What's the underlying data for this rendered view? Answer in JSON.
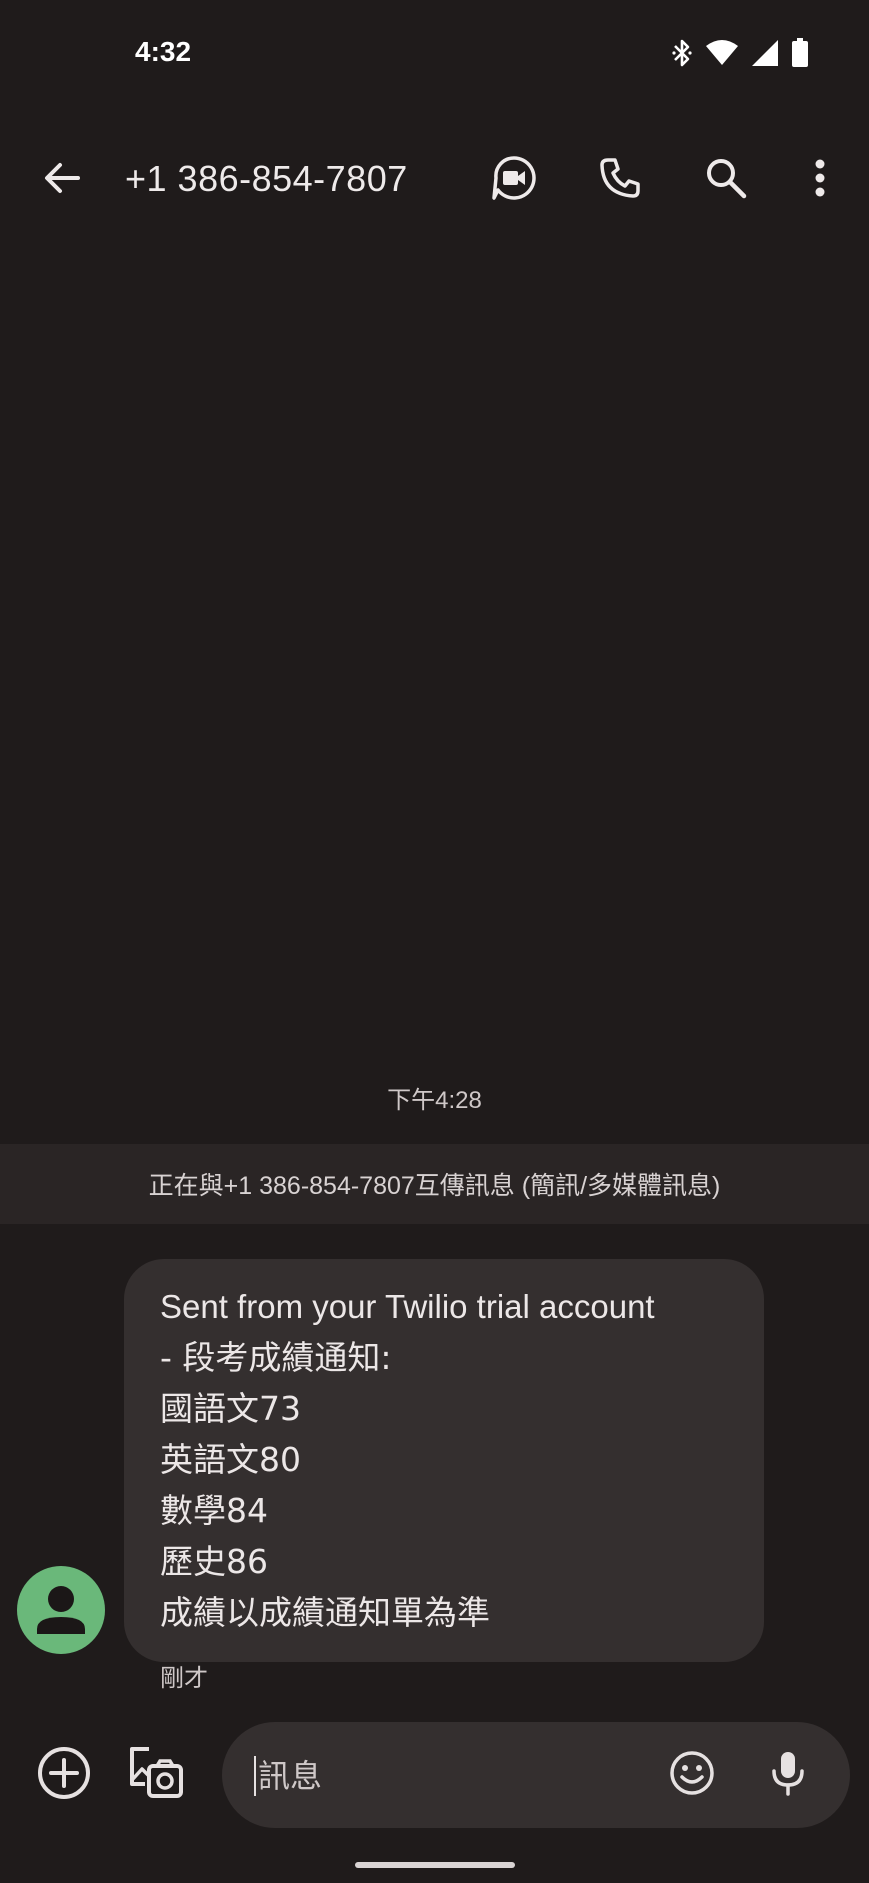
{
  "status_bar": {
    "time": "4:32"
  },
  "app_bar": {
    "title": "+1 386-854-7807"
  },
  "conversation": {
    "timestamp": "下午4:28",
    "info_banner": "正在與+1 386-854-7807互傳訊息 (簡訊/多媒體訊息)",
    "message": {
      "lines": [
        "Sent from your Twilio trial account",
        "- 段考成績通知:",
        "國語文73",
        "英語文80",
        "數學84",
        "歷史86",
        "成績以成績通知單為準"
      ],
      "meta": "剛才"
    }
  },
  "composer": {
    "placeholder": "訊息"
  },
  "colors": {
    "background": "#1f1b1b",
    "bubble": "#342f2f",
    "avatar": "#6ab87a",
    "banner": "#2a2525"
  },
  "icons": {
    "back": "arrow-back-icon",
    "video": "video-call-icon",
    "call": "phone-icon",
    "search": "search-icon",
    "more": "more-vert-icon",
    "add": "add-circle-icon",
    "media": "gallery-camera-icon",
    "emoji": "emoji-icon",
    "mic": "mic-icon"
  }
}
